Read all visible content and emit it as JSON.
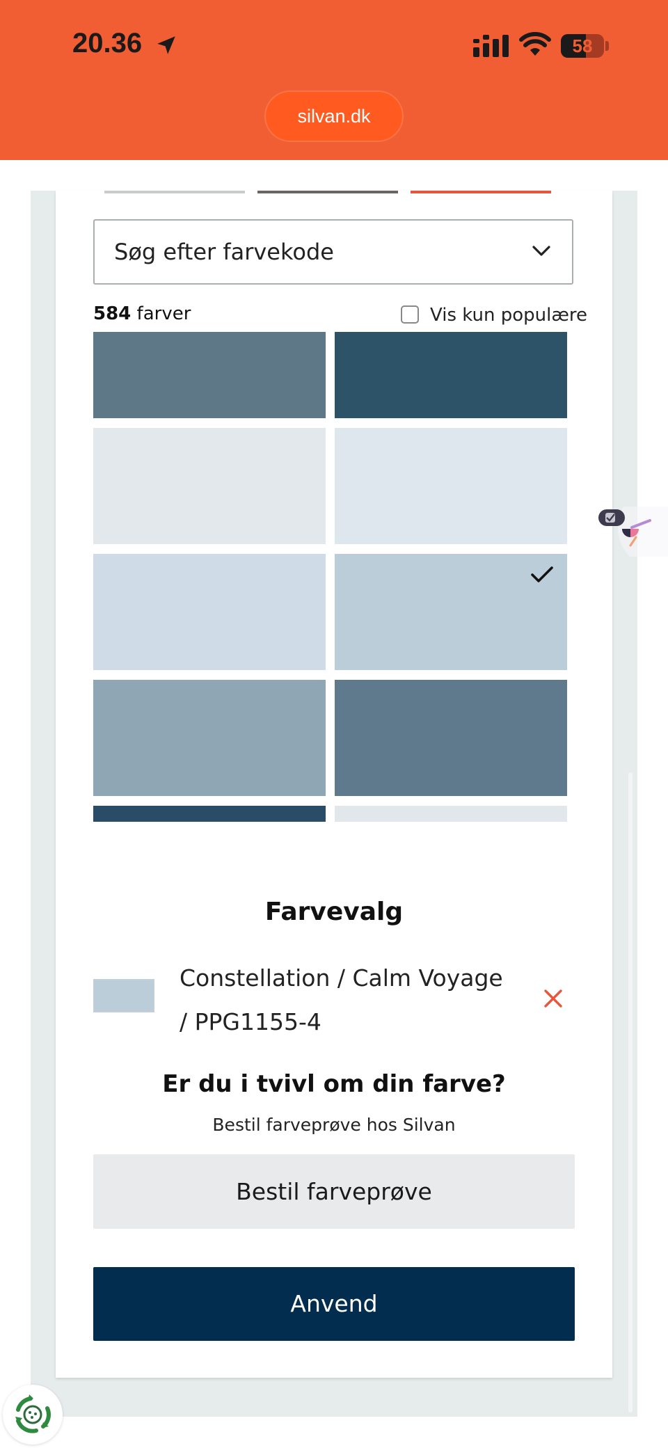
{
  "status_bar": {
    "time": "20.36",
    "battery": "58",
    "battery_fraction": 0.58
  },
  "browser": {
    "url": "silvan.dk"
  },
  "colors": {
    "brand_orange": "#f25e33",
    "primary_navy": "#032d4f",
    "remove_red": "#e8553a"
  },
  "search": {
    "label": "Søg efter farvekode"
  },
  "list_info": {
    "count": "584",
    "count_unit": "farver",
    "popular_only_label": "Vis kun populære",
    "popular_only_checked": false
  },
  "swatches": [
    {
      "color": "#5e7887",
      "selected": false
    },
    {
      "color": "#2d5369",
      "selected": false
    },
    {
      "color": "#e2e8ec",
      "selected": false
    },
    {
      "color": "#dee7ee",
      "selected": false
    },
    {
      "color": "#cfdce7",
      "selected": false
    },
    {
      "color": "#bccdda",
      "selected": true
    },
    {
      "color": "#8fa6b5",
      "selected": false
    },
    {
      "color": "#5f7a8d",
      "selected": false
    },
    {
      "color": "#2b4c66",
      "selected": false
    },
    {
      "color": "#e1e7ea",
      "selected": false
    }
  ],
  "selection": {
    "title": "Farvevalg",
    "chosen_color": "#bccdda",
    "chosen_name": "Constellation / Calm Voyage / PPG1155-4"
  },
  "help": {
    "title": "Er du i tvivl om din farve?",
    "subtitle": "Bestil farveprøve hos Silvan",
    "sample_button": "Bestil farveprøve"
  },
  "actions": {
    "apply_button": "Anvend"
  },
  "icons": [
    "location-arrow-icon",
    "cellular-signal-icon",
    "wifi-icon",
    "battery-icon",
    "chevron-down-icon",
    "checkmark-icon",
    "close-icon",
    "chat-widget-icon",
    "recycle-icon"
  ]
}
